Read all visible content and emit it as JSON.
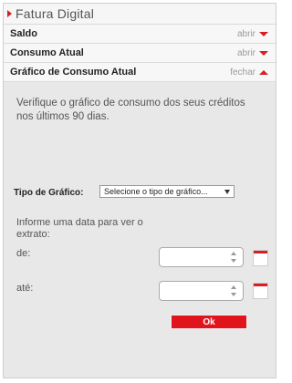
{
  "header": {
    "title": "Fatura Digital"
  },
  "sections": [
    {
      "label": "Saldo",
      "action": "abrir",
      "state": "closed"
    },
    {
      "label": "Consumo Atual",
      "action": "abrir",
      "state": "closed"
    },
    {
      "label": "Gráfico de Consumo Atual",
      "action": "fechar",
      "state": "open"
    }
  ],
  "content": {
    "description": "Verifique o gráfico de consumo dos seus créditos nos últimos 90 dias.",
    "chart_type_label": "Tipo de Gráfico:",
    "chart_type_select": "Selecione o tipo de gráfico...",
    "inform_text": "Informe uma data para ver o extrato:",
    "from_label": "de:",
    "to_label": "até:",
    "from_value": "",
    "to_value": "",
    "ok_label": "Ok"
  },
  "colors": {
    "accent": "#e1141c",
    "panel_bg": "#e8e8e8"
  },
  "icons": {
    "header": "triangle-right-icon",
    "closed": "arrow-down-icon",
    "open": "arrow-up-icon",
    "calendar": "calendar-icon"
  }
}
